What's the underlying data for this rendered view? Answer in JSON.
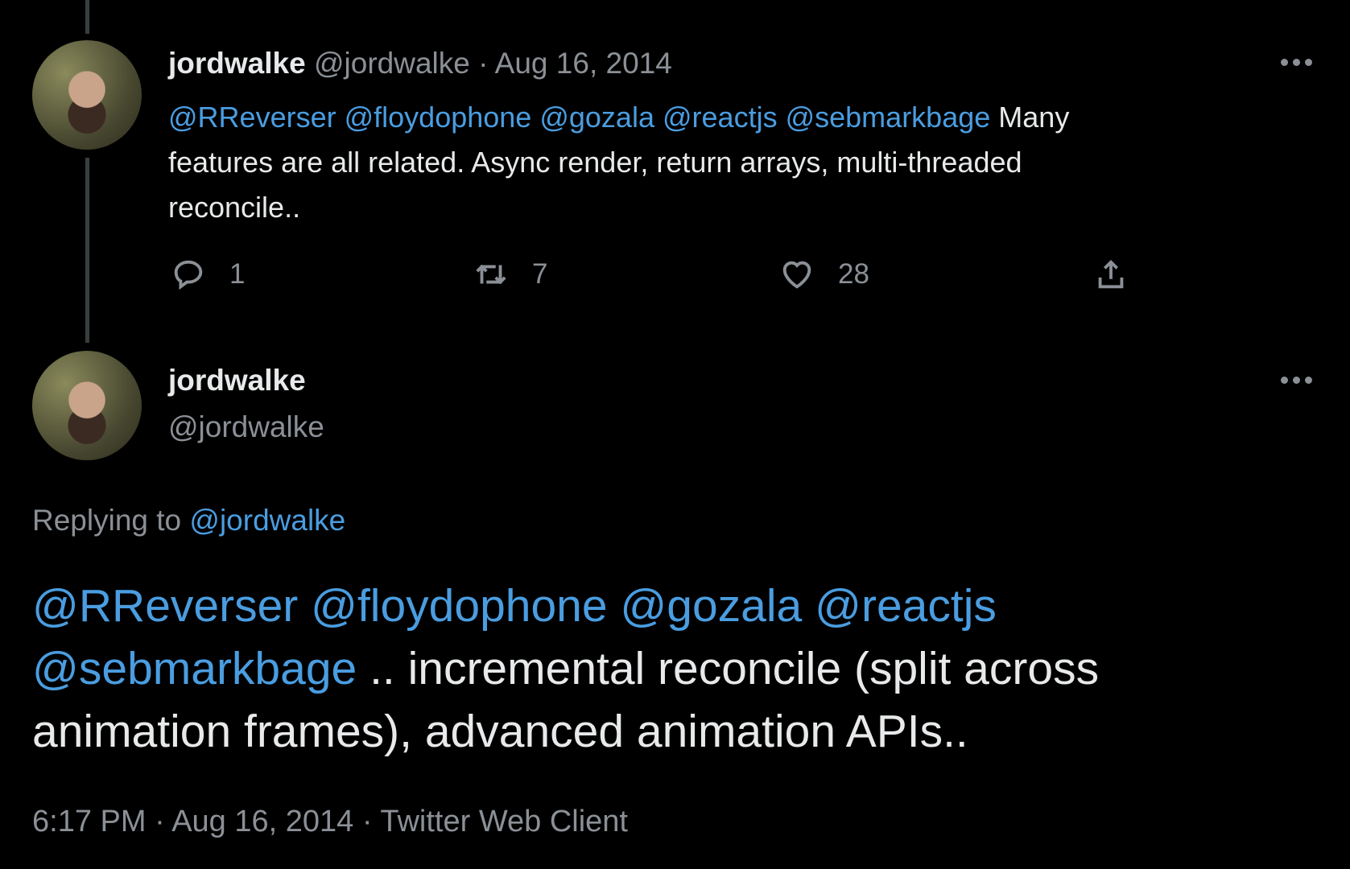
{
  "tweet1": {
    "display_name": "jordwalke",
    "handle": "@jordwalke",
    "date": "· Aug 16, 2014",
    "mentions": [
      "@RReverser",
      "@floydophone",
      "@gozala",
      "@reactjs",
      "@sebmarkbage"
    ],
    "text_line1": "Many",
    "text_line2": "features are all related. Async render, return arrays, multi-threaded",
    "text_line3": "reconcile..",
    "replies": "1",
    "retweets": "7",
    "likes": "28"
  },
  "tweet2": {
    "display_name": "jordwalke",
    "handle": "@jordwalke",
    "replying_label": "Replying to",
    "replying_handle": "@jordwalke",
    "mentions": [
      "@RReverser",
      "@floydophone",
      "@gozala",
      "@reactjs",
      "@sebmarkbage"
    ],
    "text_line2": ".. incremental reconcile (split across",
    "text_line3": "animation frames), advanced animation APIs..",
    "footer": "6:17 PM · Aug 16, 2014 · Twitter Web Client"
  },
  "colors": {
    "background": "#000000",
    "link": "#4a9de0",
    "muted": "#8b9096"
  }
}
